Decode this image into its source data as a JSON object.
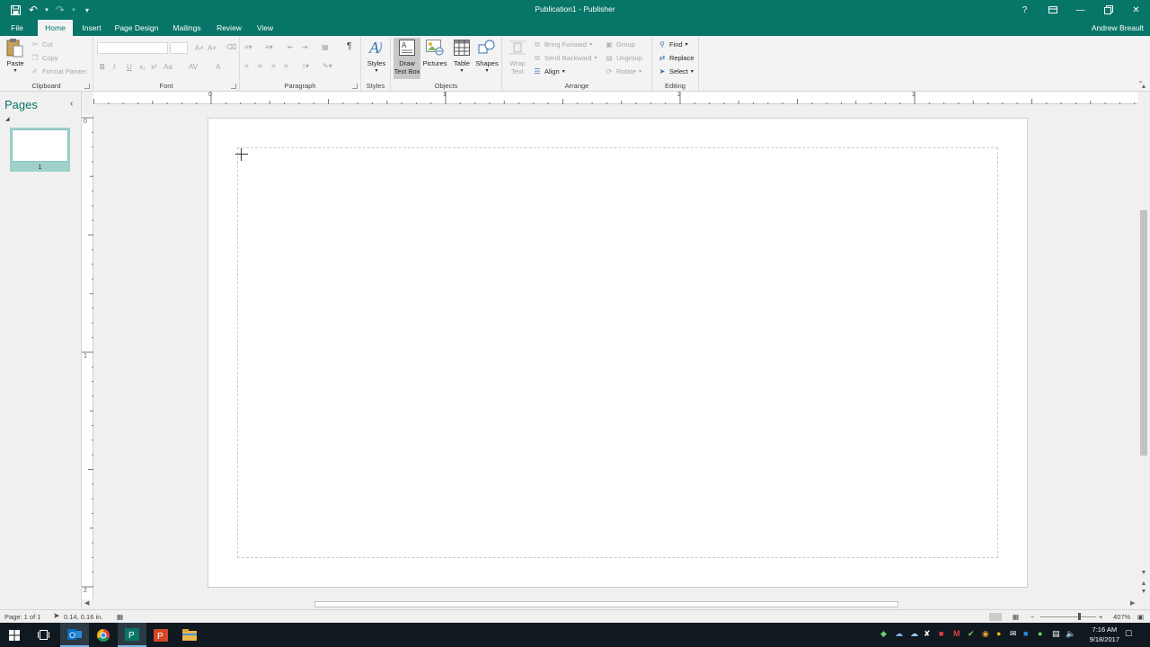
{
  "titlebar": {
    "doc_title": "Publication1 - Publisher",
    "qat": [
      "save-icon",
      "undo-icon",
      "redo-icon",
      "customize-icon"
    ],
    "help": "?",
    "window_buttons": [
      "ribbon-display-icon",
      "minimize-icon",
      "restore-icon",
      "close-icon"
    ]
  },
  "tabs": {
    "file": "File",
    "home": "Home",
    "insert": "Insert",
    "page_design": "Page Design",
    "mailings": "Mailings",
    "review": "Review",
    "view": "View",
    "user": "Andrew Breault"
  },
  "ribbon": {
    "clipboard": {
      "label": "Clipboard",
      "paste": "Paste",
      "cut": "Cut",
      "copy": "Copy",
      "format_painter": "Format Painter"
    },
    "font": {
      "label": "Font",
      "bold": "B",
      "italic": "I",
      "underline": "U",
      "subscript": "x₂",
      "superscript": "x²",
      "change_case": "Aa",
      "char_spacing": "AV",
      "font_color": "A",
      "grow": "A˄",
      "shrink": "A˅"
    },
    "paragraph": {
      "label": "Paragraph",
      "show_marks": "¶"
    },
    "styles": {
      "label": "Styles",
      "button": "Styles"
    },
    "objects": {
      "label": "Objects",
      "draw_text_box_1": "Draw",
      "draw_text_box_2": "Text Box",
      "pictures": "Pictures",
      "table": "Table",
      "shapes": "Shapes"
    },
    "arrange": {
      "label": "Arrange",
      "wrap_1": "Wrap",
      "wrap_2": "Text",
      "bring_forward": "Bring Forward",
      "send_backward": "Send Backward",
      "align": "Align",
      "group": "Group",
      "ungroup": "Ungroup",
      "rotate": "Rotate"
    },
    "editing": {
      "label": "Editing",
      "find": "Find",
      "replace": "Replace",
      "select": "Select"
    }
  },
  "ruler": {
    "h_numbers": [
      "0",
      "1",
      "2",
      "3"
    ],
    "v_numbers": [
      "0",
      "1",
      "2"
    ]
  },
  "pages_pane": {
    "title": "Pages",
    "page_number": "1"
  },
  "status": {
    "page": "Page: 1 of 1",
    "position": "0.14, 0.16 in.",
    "zoom": "407%"
  },
  "taskbar": {
    "time": "7:16 AM",
    "date": "9/18/2017"
  },
  "colors": {
    "accent": "#077568",
    "thumb_highlight": "#9fd0ca"
  }
}
